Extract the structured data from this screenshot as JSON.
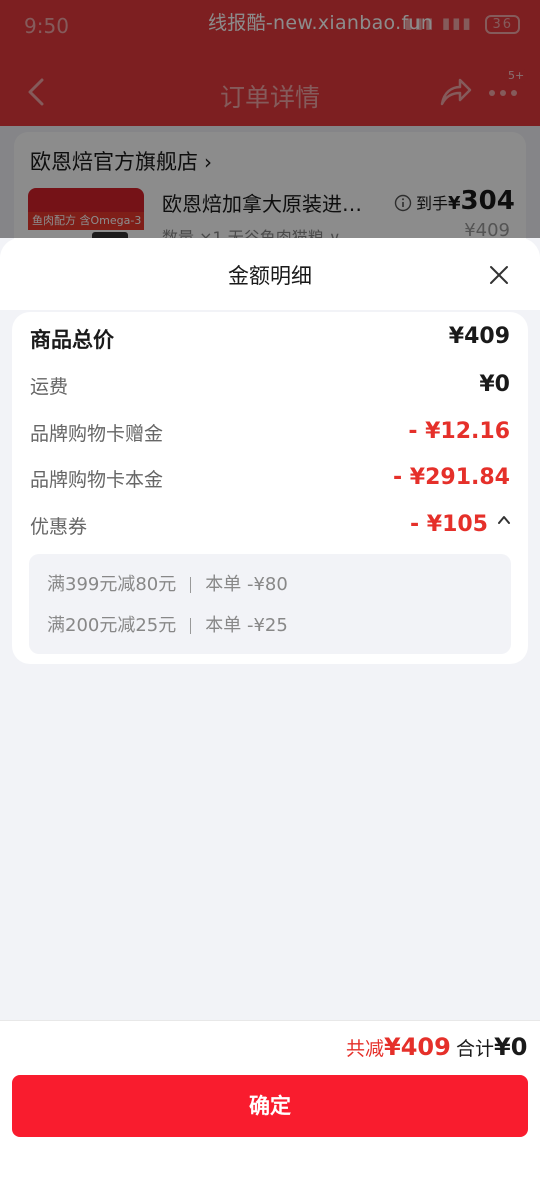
{
  "status_bar": {
    "time": "9:50",
    "watermark": "线报酷-new.xianbao.fun",
    "battery": "36"
  },
  "navbar": {
    "title": "订单详情",
    "more_badge": "5+"
  },
  "store": {
    "name": "欧恩焙官方旗舰店",
    "product_title": "欧恩焙加拿大原装进…",
    "thumb_text": "鱼肉配方 含Omega-3",
    "net_price_label": "到手",
    "net_price_yen": "¥",
    "net_price": "304",
    "original_price": "¥409",
    "sub_text": "数量 ×1  无谷鱼肉猫粮  ∨"
  },
  "sheet": {
    "title": "金额明细",
    "rows": [
      {
        "label": "商品总价",
        "value": "¥409"
      },
      {
        "label": "运费",
        "value": "¥0"
      },
      {
        "label": "品牌购物卡赠金",
        "value": "- ¥12.16"
      },
      {
        "label": "品牌购物卡本金",
        "value": "- ¥291.84"
      },
      {
        "label": "优惠券",
        "value": "- ¥105"
      }
    ],
    "coupons": [
      {
        "condition": "满399元减80元",
        "applied": "本单 -¥80"
      },
      {
        "condition": "满200元减25元",
        "applied": "本单 -¥25"
      }
    ]
  },
  "footer": {
    "saved_label": "共减",
    "saved_amount": "¥409",
    "total_label": "合计",
    "total_amount": "¥0",
    "confirm_label": "确定"
  },
  "colors": {
    "brand_red": "#e4393c",
    "discount_red": "#e5302a",
    "confirm_red": "#f91c2e",
    "sheet_bg": "#f2f3f7"
  }
}
